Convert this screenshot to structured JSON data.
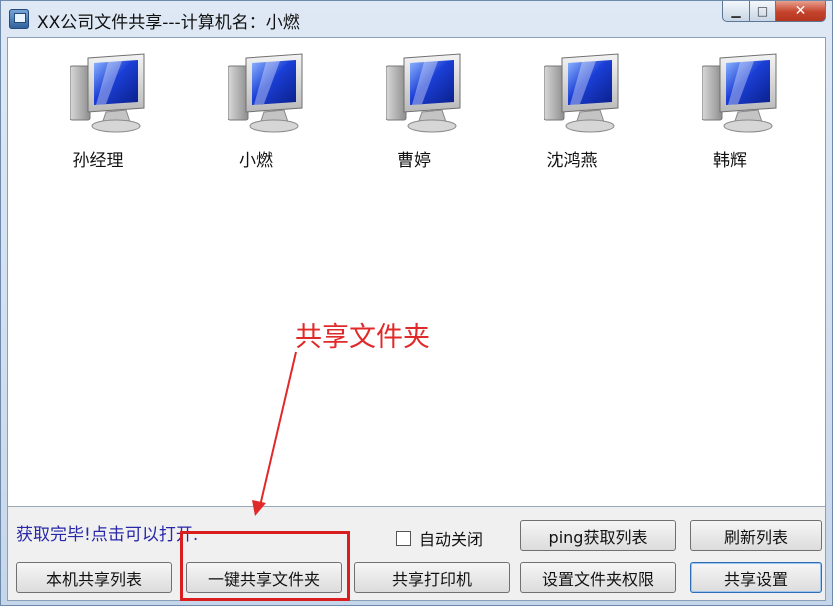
{
  "window": {
    "title": "XX公司文件共享---计算机名：小燃"
  },
  "computers": [
    {
      "name": "孙经理"
    },
    {
      "name": "小燃"
    },
    {
      "name": "曹婷"
    },
    {
      "name": "沈鸿燕"
    },
    {
      "name": "韩辉"
    }
  ],
  "annotation": {
    "text": "共享文件夹"
  },
  "status": {
    "text": "获取完毕!点击可以打开."
  },
  "auto_close": {
    "label": "自动关闭",
    "checked": false
  },
  "buttons": {
    "ping_list": "ping获取列表",
    "refresh_list": "刷新列表",
    "local_share_list": "本机共享列表",
    "one_click_share_folder": "一键共享文件夹",
    "share_printer": "共享打印机",
    "set_folder_permissions": "设置文件夹权限",
    "share_settings": "共享设置"
  }
}
